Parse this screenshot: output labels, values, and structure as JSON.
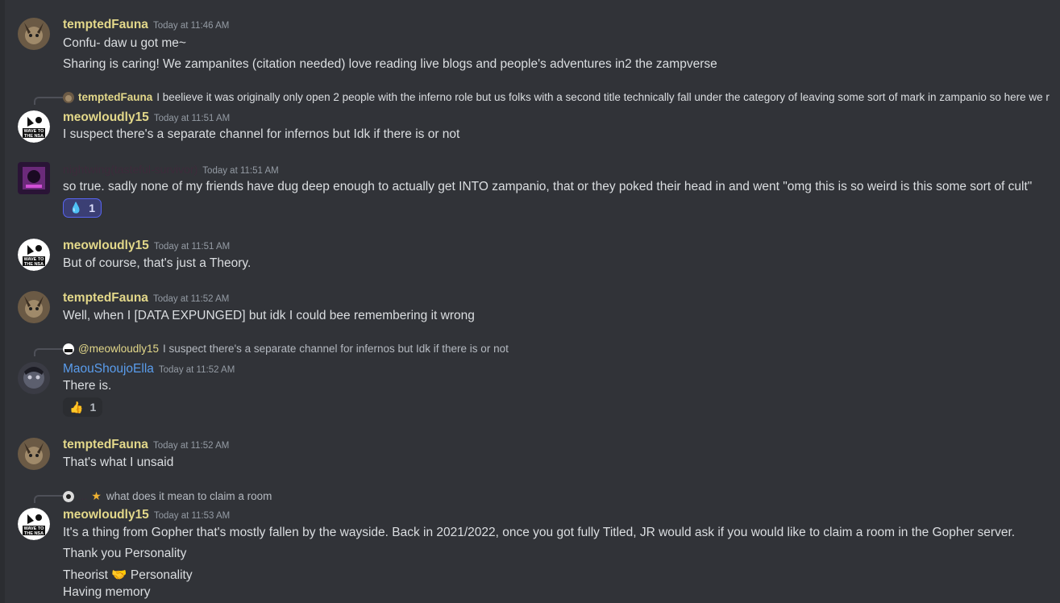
{
  "users": {
    "fauna": {
      "name": "temptedFauna",
      "color": "#e3d88a"
    },
    "meow": {
      "name": "meowloudly15",
      "color": "#e3d88a"
    },
    "ella": {
      "name": "MaouShoujoElla",
      "color": "#5a9ded"
    },
    "hidden": {
      "name": "nightwing(tasteful-survivor)",
      "color": "#3d2b3b"
    },
    "anon": {
      "name": "...",
      "color": "#3d2b3b"
    }
  },
  "avatar_text": {
    "line1": "WAVE TO",
    "line2": "THE NSA"
  },
  "messages": [
    {
      "user": "temptedFauna",
      "time": "Today at 11:46 AM",
      "lines": [
        "Confu- daw u got me~",
        "Sharing is caring! We zampanites (citation needed) love reading live blogs and people's adventures in2 the zampverse"
      ]
    },
    {
      "reply_to": {
        "name": "temptedFauna",
        "text": "I beelieve it was originally only open 2 people with the inferno role but us folks with a second title technically fall under the category of leaving some sort of mark in zampanio so here we r"
      },
      "user": "meowloudly15",
      "time": "Today at 11:51 AM",
      "lines": [
        "I suspect there's a separate channel for infernos but Idk if there is or not"
      ]
    },
    {
      "user": "nightwing(tasteful-survivor)",
      "time": "Today at 11:51 AM",
      "lines": [
        "so true. sadly none of my friends have dug deep enough to actually get INTO zampanio, that or they poked their head in and went \"omg this is so weird is this some sort of cult\""
      ],
      "reaction": {
        "emoji": "💧",
        "count": "1"
      }
    },
    {
      "user": "meowloudly15",
      "time": "Today at 11:51 AM",
      "lines": [
        "But of course, that's just a Theory."
      ]
    },
    {
      "user": "temptedFauna",
      "time": "Today at 11:52 AM",
      "lines": [
        "Well, when I [DATA EXPUNGED] but idk I could bee remembering it wrong"
      ]
    },
    {
      "reply_to": {
        "name": "@meowloudly15",
        "text": "I suspect there's a separate channel for infernos but Idk if there is or not"
      },
      "user": "MaouShoujoElla",
      "time": "Today at 11:52 AM",
      "lines": [
        "There is."
      ],
      "reaction": {
        "emoji": "👍",
        "count": "1"
      }
    },
    {
      "user": "temptedFauna",
      "time": "Today at 11:52 AM",
      "lines": [
        "That's what I unsaid"
      ]
    },
    {
      "reply_to": {
        "name": "...",
        "text": "what does it mean to claim a room"
      },
      "user": "meowloudly15",
      "time": "Today at 11:53 AM",
      "lines": [
        "It's a thing from Gopher that's mostly fallen by the wayside. Back in 2021/2022, once you got fully Titled, JR would ask if you would like to claim a room in the Gopher server.",
        "Thank you Personality",
        "Theorist 🤝 Personality",
        "Having memory"
      ]
    }
  ]
}
